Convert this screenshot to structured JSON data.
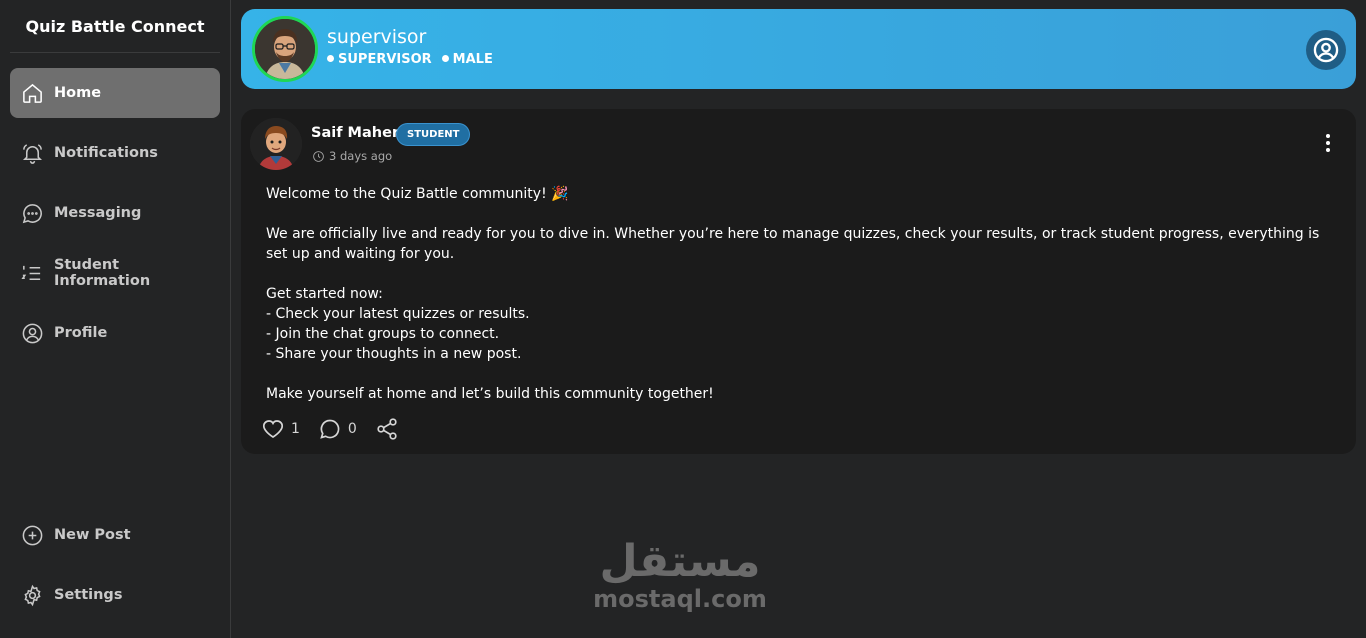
{
  "app": {
    "title": "Quiz Battle Connect"
  },
  "sidebar": {
    "items": [
      {
        "label": "Home",
        "icon": "home-icon",
        "active": true
      },
      {
        "label": "Notifications",
        "icon": "bell-icon"
      },
      {
        "label": "Messaging",
        "icon": "chat-icon"
      },
      {
        "label": "Student Information",
        "icon": "list-ordered-icon"
      },
      {
        "label": "Profile",
        "icon": "user-circle-icon"
      }
    ],
    "bottom": [
      {
        "label": "New Post",
        "icon": "plus-circle-icon"
      },
      {
        "label": "Settings",
        "icon": "gear-icon"
      }
    ]
  },
  "header": {
    "name": "supervisor",
    "role": "SUPERVISOR",
    "gender": "MALE",
    "avatar_border_color": "#1fd655",
    "gradient": [
      "#36b3e8",
      "#3a9fd8"
    ]
  },
  "post": {
    "author": "Saif Maher",
    "role": "STUDENT",
    "time": "3 days ago",
    "lines": {
      "l1": "Welcome to the Quiz Battle community! 🎉",
      "l2": "We are officially live and ready for you to dive in. Whether you’re here to manage quizzes, check your results, or track student progress, everything is set up and waiting for you.",
      "l3": "Get started now:",
      "l4": "- Check your latest quizzes or results.",
      "l5": "- Join the chat groups to connect.",
      "l6": "- Share your thoughts in a new post.",
      "l7": "Make yourself at home and let’s build this community together!"
    },
    "likes": "1",
    "comments": "0"
  },
  "watermark": {
    "arabic": "مستقل",
    "latin": "mostaql.com"
  },
  "colors": {
    "background": "#232425",
    "card": "#1b1b1b",
    "active_nav": "#6f6f6f",
    "badge": "#206fa3"
  }
}
